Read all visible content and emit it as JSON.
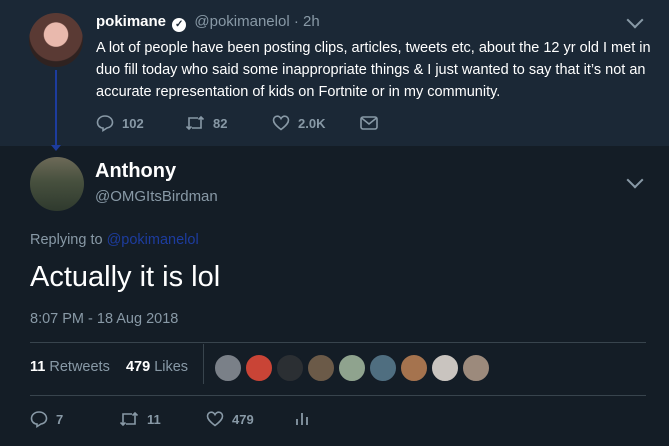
{
  "parent_tweet": {
    "name": "pokimane",
    "verified_icon": "verified-badge-icon",
    "handle": "@pokimanelol",
    "dot": "·",
    "time": "2h",
    "text": "A lot of people have been posting clips, articles, tweets etc, about the 12 yr old I met in duo fill today who said some inappropriate things & I just wanted to say that it’s not an accurate representation of kids on Fortnite or in my community.",
    "actions": {
      "replies": "102",
      "retweets": "82",
      "likes": "2.0K"
    }
  },
  "main_tweet": {
    "name": "Anthony",
    "handle": "@OMGItsBirdman",
    "replying_label": "Replying to",
    "replying_mention": "@pokimanelol",
    "text": "Actually it is lol",
    "datetime": "8:07 PM - 18 Aug 2018",
    "stats": {
      "retweets_count": "11",
      "retweets_label": "Retweets",
      "likes_count": "479",
      "likes_label": "Likes"
    },
    "actions": {
      "replies": "7",
      "retweets": "11",
      "likes": "479"
    }
  },
  "colors": {
    "background": "#141d26",
    "parent_background": "#1b2836",
    "secondary_text": "#8899a6",
    "mention": "#1d3c9e"
  }
}
